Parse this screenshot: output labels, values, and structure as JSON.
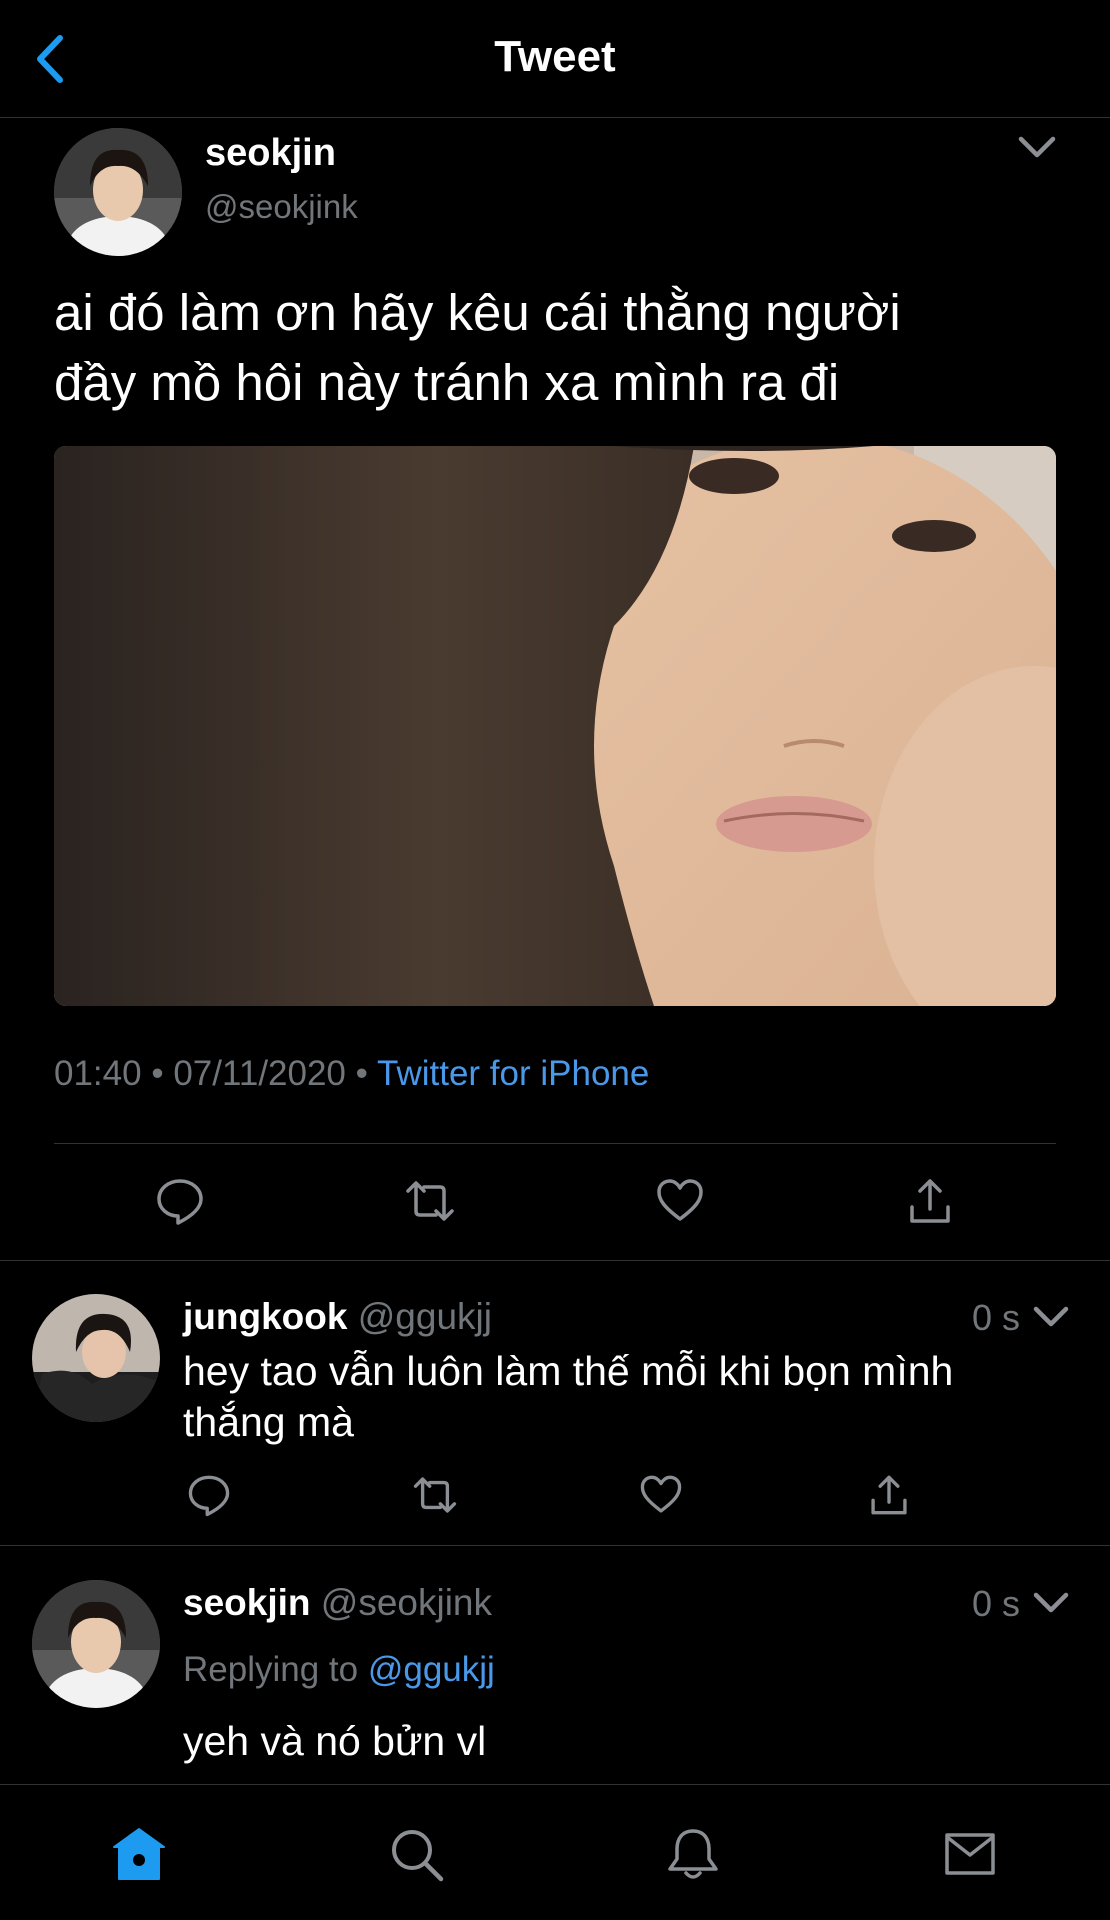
{
  "header": {
    "title": "Tweet",
    "back_icon": "chevron-left-icon"
  },
  "colors": {
    "accent": "#1d9bf0",
    "link": "#4a99e9",
    "muted": "#71767b",
    "divider": "#2f3336",
    "background": "#000000"
  },
  "tweet": {
    "author_name": "seokjin",
    "author_handle": "@seokjink",
    "text_line1": "ai đó làm ơn hãy kêu cái thằng người",
    "text_line2": "đầy mồ hôi này tránh xa mình ra đi",
    "media_icon": "photo",
    "time": "01:40",
    "date": "07/11/2020",
    "separator": "•",
    "source": "Twitter for iPhone",
    "actions": [
      "reply-icon",
      "retweet-icon",
      "like-icon",
      "share-icon"
    ]
  },
  "replies": [
    {
      "author_name": "jungkook",
      "author_handle": "@ggukjj",
      "time": "0 s",
      "text_line1": "hey tao vẫn luôn làm thế mỗi khi bọn mình",
      "text_line2": "thắng mà"
    },
    {
      "author_name": "seokjin",
      "author_handle": "@seokjink",
      "time": "0 s",
      "replying_prefix": "Replying to",
      "replying_to": "@ggukjj",
      "text": "yeh và nó bửn vl"
    }
  ],
  "tabbar": {
    "items": [
      "home-icon",
      "search-icon",
      "notifications-icon",
      "messages-icon"
    ],
    "active": "home-icon"
  }
}
